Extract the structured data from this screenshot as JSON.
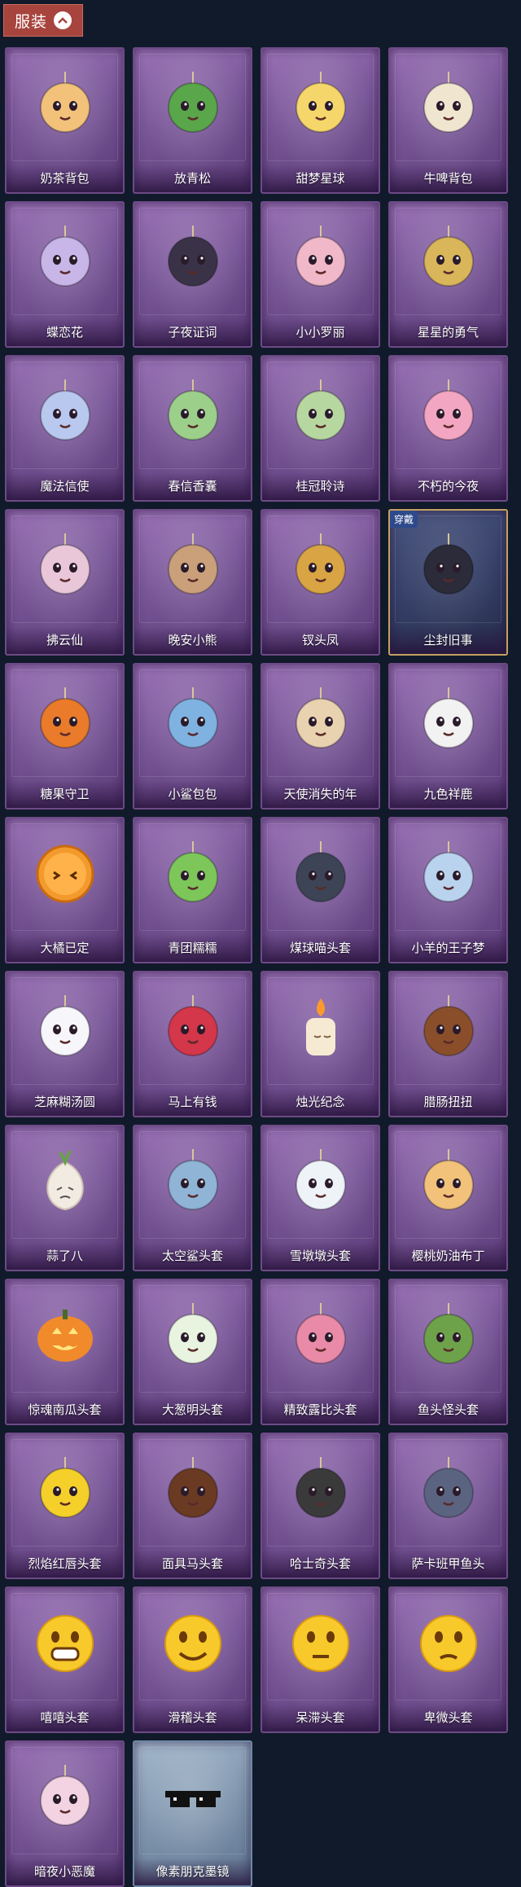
{
  "header": {
    "label": "服装"
  },
  "items": [
    {
      "name": "奶茶背包",
      "icon": "milk-tea-bag-icon",
      "color": "#f2c27a"
    },
    {
      "name": "放青松",
      "icon": "pine-tree-pot-icon",
      "color": "#5aa64a"
    },
    {
      "name": "甜梦星球",
      "icon": "moon-fox-icon",
      "color": "#f5d66a"
    },
    {
      "name": "牛啤背包",
      "icon": "cow-beer-bag-icon",
      "color": "#f0e6d0"
    },
    {
      "name": "蝶恋花",
      "icon": "butterfly-wreath-icon",
      "color": "#c8b6e8"
    },
    {
      "name": "子夜证词",
      "icon": "crow-icon",
      "color": "#3a3348"
    },
    {
      "name": "小小罗丽",
      "icon": "doll-girl-icon",
      "color": "#f0b8c8"
    },
    {
      "name": "星星的勇气",
      "icon": "star-pendant-icon",
      "color": "#d9b65a"
    },
    {
      "name": "魔法信使",
      "icon": "elephant-icon",
      "color": "#b9c8ee"
    },
    {
      "name": "春信香囊",
      "icon": "sachet-icon",
      "color": "#9ccf8a"
    },
    {
      "name": "桂冠聆诗",
      "icon": "laurel-elf-icon",
      "color": "#b7d7a0"
    },
    {
      "name": "不朽的今夜",
      "icon": "pink-cat-cup-icon",
      "color": "#f3a6c2"
    },
    {
      "name": "拂云仙",
      "icon": "cloud-fairy-icon",
      "color": "#e9c7d8"
    },
    {
      "name": "晚安小熊",
      "icon": "teddy-bear-icon",
      "color": "#c9a07a"
    },
    {
      "name": "钗头凤",
      "icon": "phoenix-crown-icon",
      "color": "#d8a444"
    },
    {
      "name": "尘封旧事",
      "icon": "dark-boy-icon",
      "color": "#2b2b3a",
      "equipped": true,
      "badge": "穿戴"
    },
    {
      "name": "糖果守卫",
      "icon": "pumpkin-scarecrow-icon",
      "color": "#e97b2a"
    },
    {
      "name": "小鲨包包",
      "icon": "shark-bag-icon",
      "color": "#7fb2e0"
    },
    {
      "name": "天使消失的年",
      "icon": "angel-portrait-icon",
      "color": "#e8d2b0"
    },
    {
      "name": "九色祥鹿",
      "icon": "deer-icon",
      "color": "#f2f2f2"
    },
    {
      "name": "大橘已定",
      "icon": "orange-slice-icon",
      "color": "#f39a2c"
    },
    {
      "name": "青团糯糯",
      "icon": "green-dumpling-icon",
      "color": "#7cc65a"
    },
    {
      "name": "煤球喵头套",
      "icon": "black-cat-head-icon",
      "color": "#3c4456"
    },
    {
      "name": "小羊的王子梦",
      "icon": "sheep-crown-icon",
      "color": "#b9d3ee"
    },
    {
      "name": "芝麻糊汤圆",
      "icon": "rice-ball-icon",
      "color": "#f7f7fb"
    },
    {
      "name": "马上有钱",
      "icon": "red-horse-icon",
      "color": "#d4364a"
    },
    {
      "name": "烛光纪念",
      "icon": "candle-icon",
      "color": "#f6ead2"
    },
    {
      "name": "腊肠扭扭",
      "icon": "dachshund-icon",
      "color": "#8a4f2a"
    },
    {
      "name": "蒜了八",
      "icon": "garlic-icon",
      "color": "#f1ebe2"
    },
    {
      "name": "太空鲨头套",
      "icon": "space-shark-icon",
      "color": "#8fb4d6"
    },
    {
      "name": "雪墩墩头套",
      "icon": "snowman-icon",
      "color": "#eef3f8"
    },
    {
      "name": "樱桃奶油布丁",
      "icon": "pudding-icon",
      "color": "#f2c27a"
    },
    {
      "name": "惊魂南瓜头套",
      "icon": "jack-o-lantern-icon",
      "color": "#f08a2a"
    },
    {
      "name": "大葱明头套",
      "icon": "green-onion-icon",
      "color": "#e8f4e0"
    },
    {
      "name": "精致露比头套",
      "icon": "pink-dog-icon",
      "color": "#e98aa8"
    },
    {
      "name": "鱼头怪头套",
      "icon": "fish-head-icon",
      "color": "#6ea24a"
    },
    {
      "name": "烈焰红唇头套",
      "icon": "yellow-mask-sunglasses-icon",
      "color": "#f5d02a"
    },
    {
      "name": "面具马头套",
      "icon": "horse-head-icon",
      "color": "#6a3a22"
    },
    {
      "name": "哈士奇头套",
      "icon": "husky-head-icon",
      "color": "#3a3a3a"
    },
    {
      "name": "萨卡班甲鱼头",
      "icon": "sacabambaspis-icon",
      "color": "#5a6480"
    },
    {
      "name": "嘻嘻头套",
      "icon": "grin-emoji-icon",
      "color": "#f7c92a"
    },
    {
      "name": "滑稽头套",
      "icon": "funny-emoji-icon",
      "color": "#f7c92a"
    },
    {
      "name": "呆滞头套",
      "icon": "blank-stare-emoji-icon",
      "color": "#f7c92a"
    },
    {
      "name": "卑微头套",
      "icon": "humble-emoji-icon",
      "color": "#f7c92a"
    },
    {
      "name": "暗夜小恶魔",
      "icon": "little-devil-icon",
      "color": "#f3d2e2"
    },
    {
      "name": "像素朋克墨镜",
      "icon": "pixel-sunglasses-icon",
      "color": "#111111",
      "blue": true
    }
  ]
}
